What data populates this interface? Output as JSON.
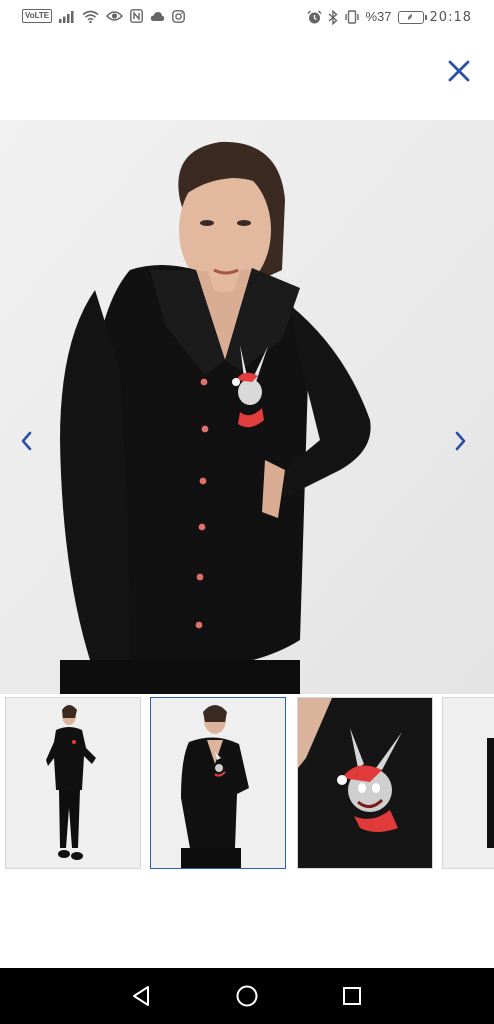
{
  "status_bar": {
    "volte": "VoLTE",
    "signal_icon": "signal-bars-icon",
    "wifi_icon": "wifi-icon",
    "eye_icon": "eye-icon",
    "nfc_icon": "nfc-icon",
    "cloud_icon": "cloud-icon",
    "instagram_icon": "instagram-icon",
    "alarm_icon": "alarm-icon",
    "bluetooth_icon": "bluetooth-icon",
    "vibrate_icon": "vibrate-icon",
    "battery_percent": "%37",
    "time": "20:18"
  },
  "header": {
    "close_icon": "close-icon",
    "accent_color": "#2a4fa8"
  },
  "gallery": {
    "main_image_alt": "woman-wearing-black-pajama-shirt",
    "prev_icon": "chevron-left-icon",
    "next_icon": "chevron-right-icon",
    "selected_index": 1,
    "thumbnails": [
      {
        "label": "thumb-full-length"
      },
      {
        "label": "thumb-half-body"
      },
      {
        "label": "thumb-closeup-print"
      },
      {
        "label": "thumb-partial"
      }
    ]
  },
  "system_nav": {
    "back_icon": "back-triangle-icon",
    "home_icon": "home-circle-icon",
    "recents_icon": "recents-square-icon"
  }
}
